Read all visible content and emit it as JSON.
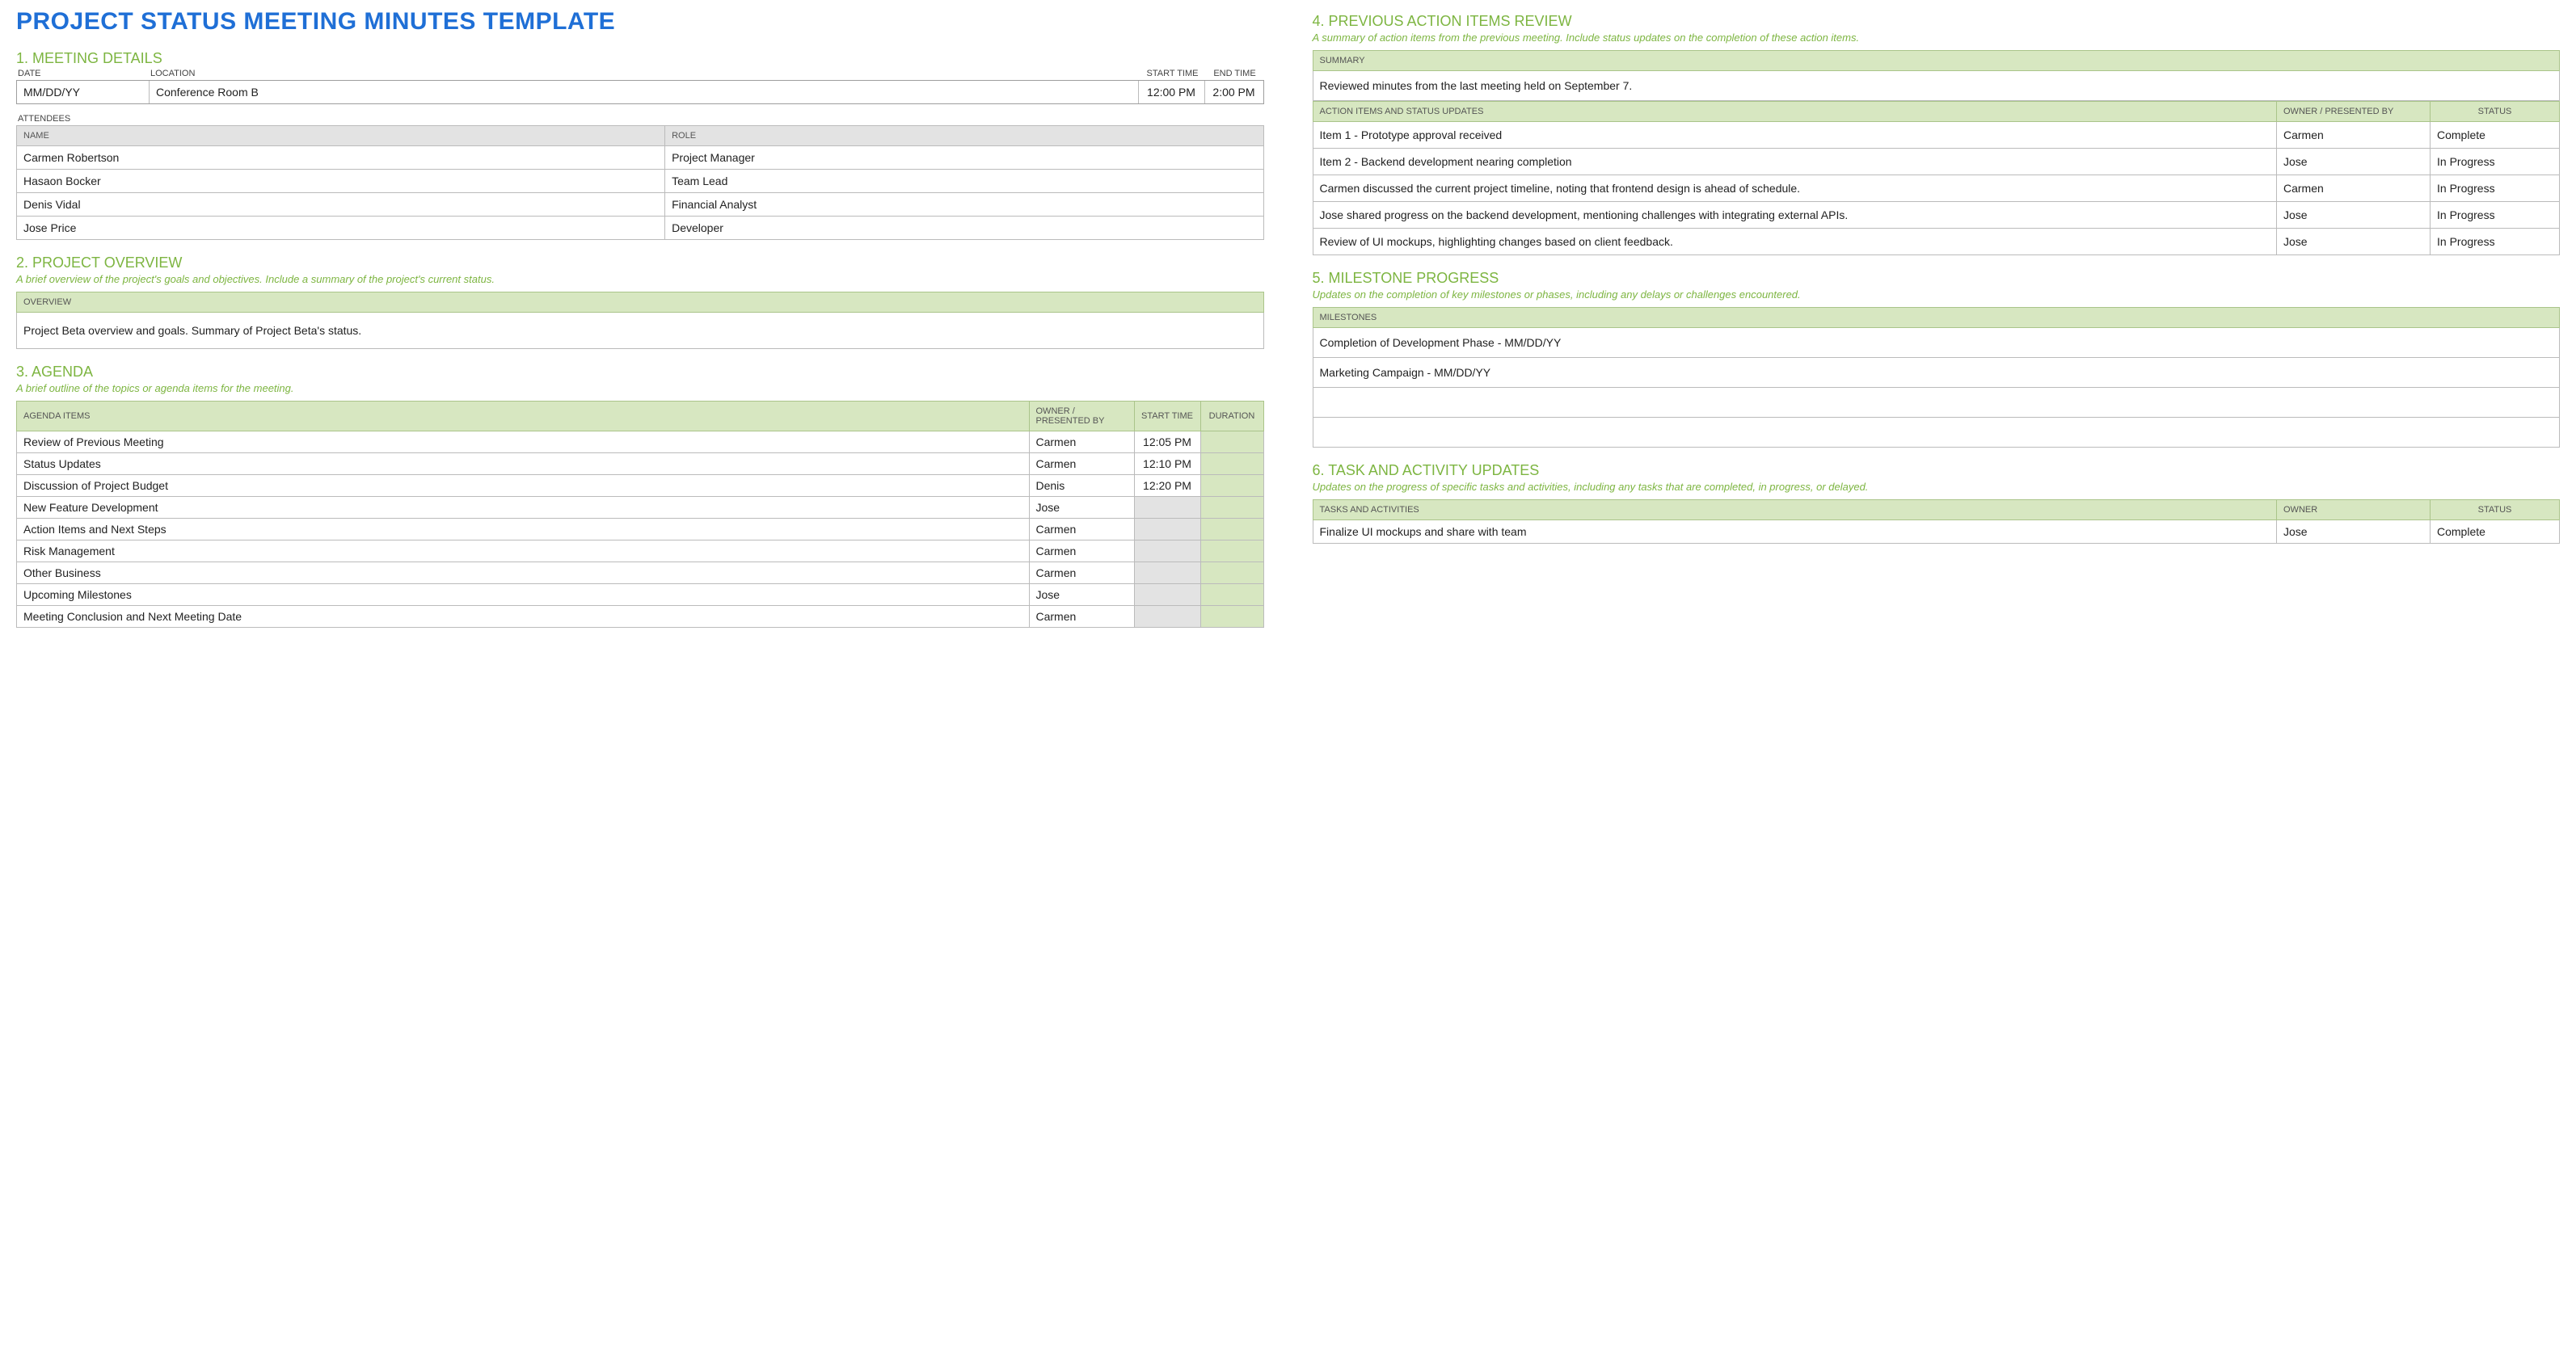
{
  "title": "PROJECT STATUS MEETING MINUTES TEMPLATE",
  "s1": {
    "heading": "1. MEETING DETAILS",
    "labels": {
      "date": "DATE",
      "location": "LOCATION",
      "start": "START TIME",
      "end": "END TIME"
    },
    "values": {
      "date": "MM/DD/YY",
      "location": "Conference Room B",
      "start": "12:00 PM",
      "end": "2:00 PM"
    },
    "attendees_label": "ATTENDEES",
    "att_head": {
      "name": "NAME",
      "role": "ROLE"
    },
    "attendees": [
      {
        "name": "Carmen Robertson",
        "role": "Project Manager"
      },
      {
        "name": "Hasaon Bocker",
        "role": "Team Lead"
      },
      {
        "name": "Denis Vidal",
        "role": "Financial Analyst"
      },
      {
        "name": "Jose Price",
        "role": "Developer"
      }
    ]
  },
  "s2": {
    "heading": "2. PROJECT OVERVIEW",
    "desc": "A brief overview of the project's goals and objectives. Include a summary of the project's current status.",
    "head": "OVERVIEW",
    "body": "Project Beta overview and goals. Summary of Project Beta's status."
  },
  "s3": {
    "heading": "3. AGENDA",
    "desc": "A brief outline of the topics or agenda items for the meeting.",
    "head": {
      "item": "AGENDA ITEMS",
      "owner": "OWNER / PRESENTED BY",
      "start": "START TIME",
      "dur": "DURATION"
    },
    "rows": [
      {
        "item": "Review of Previous Meeting",
        "owner": "Carmen",
        "start": "12:05 PM",
        "dur": ""
      },
      {
        "item": "Status Updates",
        "owner": "Carmen",
        "start": "12:10 PM",
        "dur": ""
      },
      {
        "item": "Discussion of Project Budget",
        "owner": "Denis",
        "start": "12:20 PM",
        "dur": ""
      },
      {
        "item": "New Feature Development",
        "owner": "Jose",
        "start": "",
        "dur": ""
      },
      {
        "item": "Action Items and Next Steps",
        "owner": "Carmen",
        "start": "",
        "dur": ""
      },
      {
        "item": "Risk Management",
        "owner": "Carmen",
        "start": "",
        "dur": ""
      },
      {
        "item": "Other Business",
        "owner": "Carmen",
        "start": "",
        "dur": ""
      },
      {
        "item": "Upcoming Milestones",
        "owner": "Jose",
        "start": "",
        "dur": ""
      },
      {
        "item": "Meeting Conclusion and Next Meeting Date",
        "owner": "Carmen",
        "start": "",
        "dur": ""
      }
    ]
  },
  "s4": {
    "heading": "4. PREVIOUS ACTION ITEMS REVIEW",
    "desc": "A summary of action items from the previous meeting. Include status updates on the completion of these action items.",
    "sum_head": "SUMMARY",
    "sum_body": "Reviewed minutes from the last meeting held on September 7.",
    "head": {
      "item": "ACTION ITEMS AND STATUS UPDATES",
      "owner": "OWNER / PRESENTED BY",
      "status": "STATUS"
    },
    "rows": [
      {
        "item": "Item 1 - Prototype approval received",
        "owner": "Carmen",
        "status": "Complete"
      },
      {
        "item": "Item 2 - Backend development nearing completion",
        "owner": "Jose",
        "status": "In Progress"
      },
      {
        "item": "Carmen discussed the current project timeline, noting that frontend design is ahead of schedule.",
        "owner": "Carmen",
        "status": "In Progress"
      },
      {
        "item": "Jose shared progress on the backend development, mentioning challenges with integrating external APIs.",
        "owner": "Jose",
        "status": "In Progress"
      },
      {
        "item": "Review of UI mockups, highlighting changes based on client feedback.",
        "owner": "Jose",
        "status": "In Progress"
      }
    ]
  },
  "s5": {
    "heading": "5. MILESTONE PROGRESS",
    "desc": "Updates on the completion of key milestones or phases, including any delays or challenges encountered.",
    "head": "MILESTONES",
    "rows": [
      "Completion of Development Phase - MM/DD/YY",
      "Marketing Campaign - MM/DD/YY",
      "",
      ""
    ]
  },
  "s6": {
    "heading": "6. TASK AND ACTIVITY UPDATES",
    "desc": "Updates on the progress of specific tasks and activities, including any tasks that are completed, in progress, or delayed.",
    "head": {
      "item": "TASKS AND ACTIVITIES",
      "owner": "OWNER",
      "status": "STATUS"
    },
    "rows": [
      {
        "item": "Finalize UI mockups and share with team",
        "owner": "Jose",
        "status": "Complete"
      }
    ]
  }
}
